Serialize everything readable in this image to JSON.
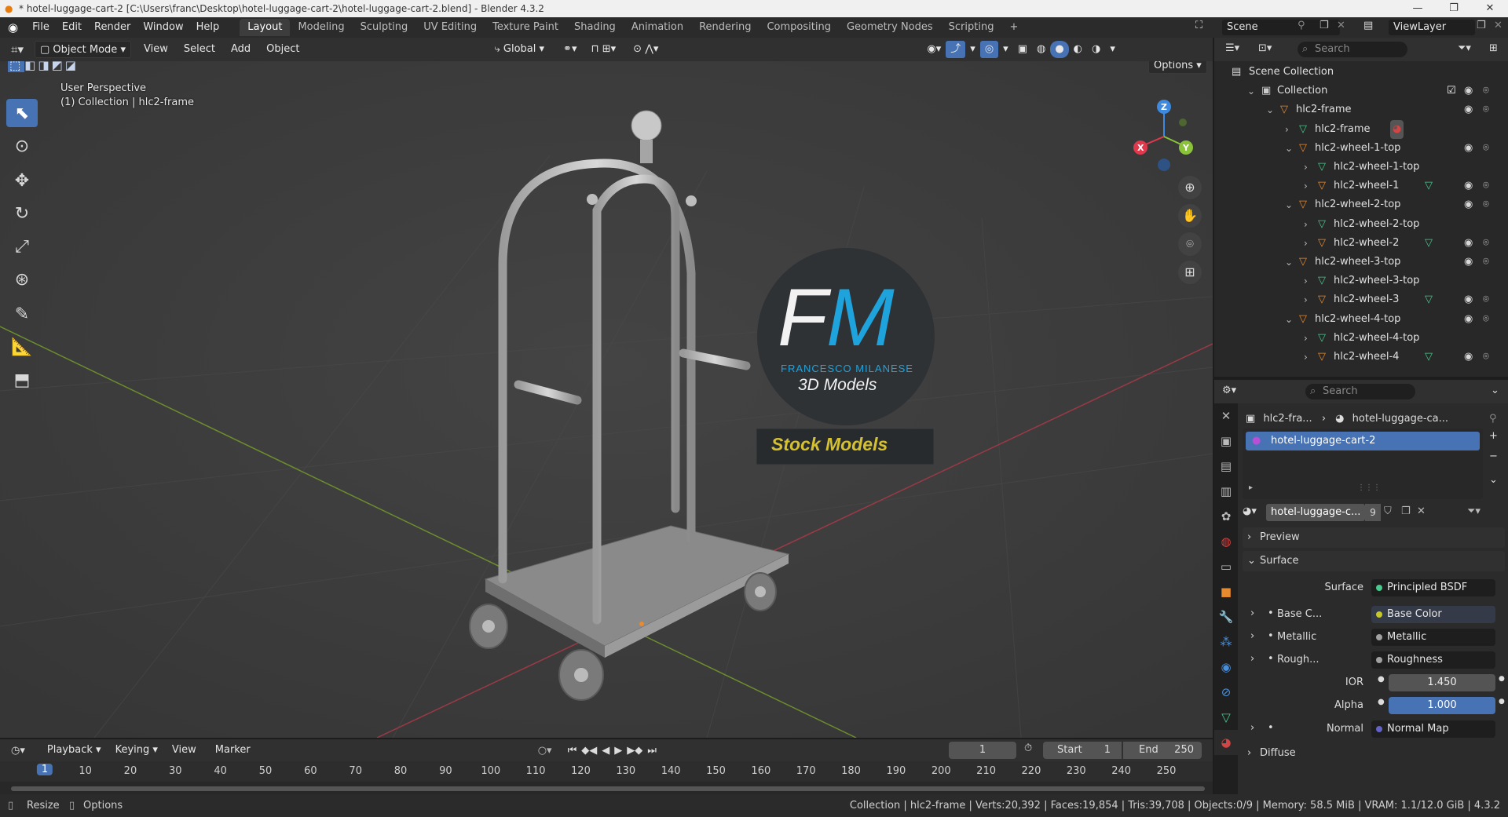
{
  "window": {
    "title": "* hotel-luggage-cart-2 [C:\\Users\\franc\\Desktop\\hotel-luggage-cart-2\\hotel-luggage-cart-2.blend] - Blender 4.3.2"
  },
  "menu": [
    "File",
    "Edit",
    "Render",
    "Window",
    "Help"
  ],
  "workspaces": [
    "Layout",
    "Modeling",
    "Sculpting",
    "UV Editing",
    "Texture Paint",
    "Shading",
    "Animation",
    "Rendering",
    "Compositing",
    "Geometry Nodes",
    "Scripting"
  ],
  "active_workspace": "Layout",
  "scene": {
    "name": "Scene",
    "view_layer": "ViewLayer"
  },
  "viewport_header": {
    "mode": "Object Mode",
    "menus": [
      "View",
      "Select",
      "Add",
      "Object"
    ],
    "transform": "Global",
    "options": "Options"
  },
  "viewport": {
    "perspective": "User Perspective",
    "collection_info": "(1) Collection | hlc2-frame",
    "axis_labels": {
      "x": "X",
      "y": "Y",
      "z": "Z"
    },
    "watermark": {
      "brand": "FRANCESCO MILANESE",
      "subtitle": "3D Models",
      "banner": "Stock Models",
      "f": "F",
      "m": "M"
    }
  },
  "outliner": {
    "search_placeholder": "Search",
    "rows": [
      {
        "label": "Scene Collection",
        "indent": 0,
        "kind": "scene"
      },
      {
        "label": "Collection",
        "indent": 1,
        "kind": "collection"
      },
      {
        "label": "hlc2-frame",
        "indent": 2,
        "kind": "object"
      },
      {
        "label": "hlc2-frame",
        "indent": 3,
        "kind": "mesh"
      },
      {
        "label": "hlc2-wheel-1-top",
        "indent": 3,
        "kind": "object"
      },
      {
        "label": "hlc2-wheel-1-top",
        "indent": 4,
        "kind": "mesh"
      },
      {
        "label": "hlc2-wheel-1",
        "indent": 4,
        "kind": "object"
      },
      {
        "label": "hlc2-wheel-2-top",
        "indent": 3,
        "kind": "object"
      },
      {
        "label": "hlc2-wheel-2-top",
        "indent": 4,
        "kind": "mesh"
      },
      {
        "label": "hlc2-wheel-2",
        "indent": 4,
        "kind": "object"
      },
      {
        "label": "hlc2-wheel-3-top",
        "indent": 3,
        "kind": "object"
      },
      {
        "label": "hlc2-wheel-3-top",
        "indent": 4,
        "kind": "mesh"
      },
      {
        "label": "hlc2-wheel-3",
        "indent": 4,
        "kind": "object"
      },
      {
        "label": "hlc2-wheel-4-top",
        "indent": 3,
        "kind": "object"
      },
      {
        "label": "hlc2-wheel-4-top",
        "indent": 4,
        "kind": "mesh"
      },
      {
        "label": "hlc2-wheel-4",
        "indent": 4,
        "kind": "object"
      }
    ]
  },
  "properties": {
    "search_placeholder": "Search",
    "breadcrumb_object": "hlc2-fra...",
    "breadcrumb_material": "hotel-luggage-ca...",
    "material_slot": "hotel-luggage-cart-2",
    "material_name": "hotel-luggage-c...",
    "users": "9",
    "panels": {
      "preview": "Preview",
      "surface": "Surface",
      "diffuse": "Diffuse"
    },
    "surface_label": "Surface",
    "surface_shader": "Principled BSDF",
    "inputs": [
      {
        "label": "Base C...",
        "value": "Base Color",
        "color": "#c7c729"
      },
      {
        "label": "Metallic",
        "value": "Metallic",
        "color": "#a1a1a1"
      },
      {
        "label": "Rough...",
        "value": "Roughness",
        "color": "#a1a1a1"
      }
    ],
    "ior": {
      "label": "IOR",
      "value": "1.450"
    },
    "alpha": {
      "label": "Alpha",
      "value": "1.000"
    },
    "normal": {
      "label": "Normal",
      "value": "Normal Map"
    }
  },
  "timeline": {
    "menus": [
      "Playback",
      "Keying",
      "View",
      "Marker"
    ],
    "current_frame": "1",
    "start_label": "Start",
    "start": "1",
    "end_label": "End",
    "end": "250",
    "ticks": [
      "1",
      "10",
      "20",
      "30",
      "40",
      "50",
      "60",
      "70",
      "80",
      "90",
      "100",
      "110",
      "120",
      "130",
      "140",
      "150",
      "160",
      "170",
      "180",
      "190",
      "200",
      "210",
      "220",
      "230",
      "240",
      "250"
    ]
  },
  "statusbar": {
    "resize": "Resize",
    "options": "Options",
    "info": "Collection | hlc2-frame | Verts:20,392 | Faces:19,854 | Tris:39,708 | Objects:0/9 | Memory: 58.5 MiB | VRAM: 1.1/12.0 GiB | 4.3.2"
  },
  "colors": {
    "accent": "#4772b3",
    "object_orange": "#e88a2e",
    "mesh_green": "#49c98c",
    "axis_x": "#e0394e",
    "axis_y": "#8ac33a",
    "axis_z": "#3d8ae0"
  }
}
